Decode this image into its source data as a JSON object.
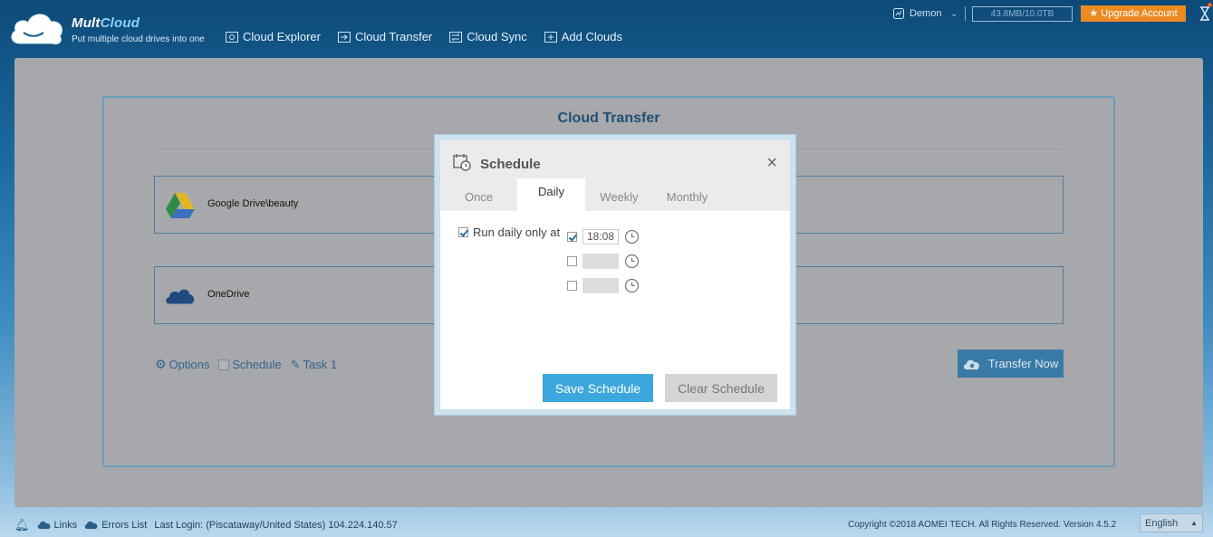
{
  "app": {
    "name_part1": "Mult",
    "name_part2": "Cloud",
    "tagline": "Put multiple cloud drives into one"
  },
  "nav": [
    {
      "label": "Cloud Explorer",
      "icon": "cloud-explorer-icon"
    },
    {
      "label": "Cloud Transfer",
      "icon": "cloud-transfer-icon"
    },
    {
      "label": "Cloud Sync",
      "icon": "cloud-sync-icon"
    },
    {
      "label": "Add Clouds",
      "icon": "add-clouds-icon"
    }
  ],
  "account": {
    "user": "Demon",
    "quota": "43.8MB/10.0TB",
    "upgrade": "★ Upgrade Account"
  },
  "main": {
    "title": "Cloud Transfer",
    "source_label": "Google Drive\\beauty",
    "target_label": "OneDrive",
    "options_label": "Options",
    "schedule_label": "Schedule",
    "task_label": "Task 1",
    "transfer_button": "Transfer Now"
  },
  "modal": {
    "title": "Schedule",
    "close": "×",
    "tabs": [
      "Once",
      "Daily",
      "Weekly",
      "Monthly"
    ],
    "active_tab": "Daily",
    "run_label": "Run daily only at",
    "times": [
      {
        "value": "18:08",
        "checked": true
      },
      {
        "value": "",
        "checked": false
      },
      {
        "value": "",
        "checked": false
      }
    ],
    "save_button": "Save Schedule",
    "clear_button": "Clear Schedule"
  },
  "footer": {
    "links": "Links",
    "errors": "Errors List",
    "last_login": "Last Login: (Piscataway/United States) 104.224.140.57",
    "copyright": "Copyright ©2018 AOMEI TECH. All Rights Reserved. Version 4.5.2",
    "language": "English"
  },
  "colors": {
    "accent": "#3ca7dc",
    "upgrade": "#ec8a22",
    "header_bg": "#0d4a78"
  }
}
